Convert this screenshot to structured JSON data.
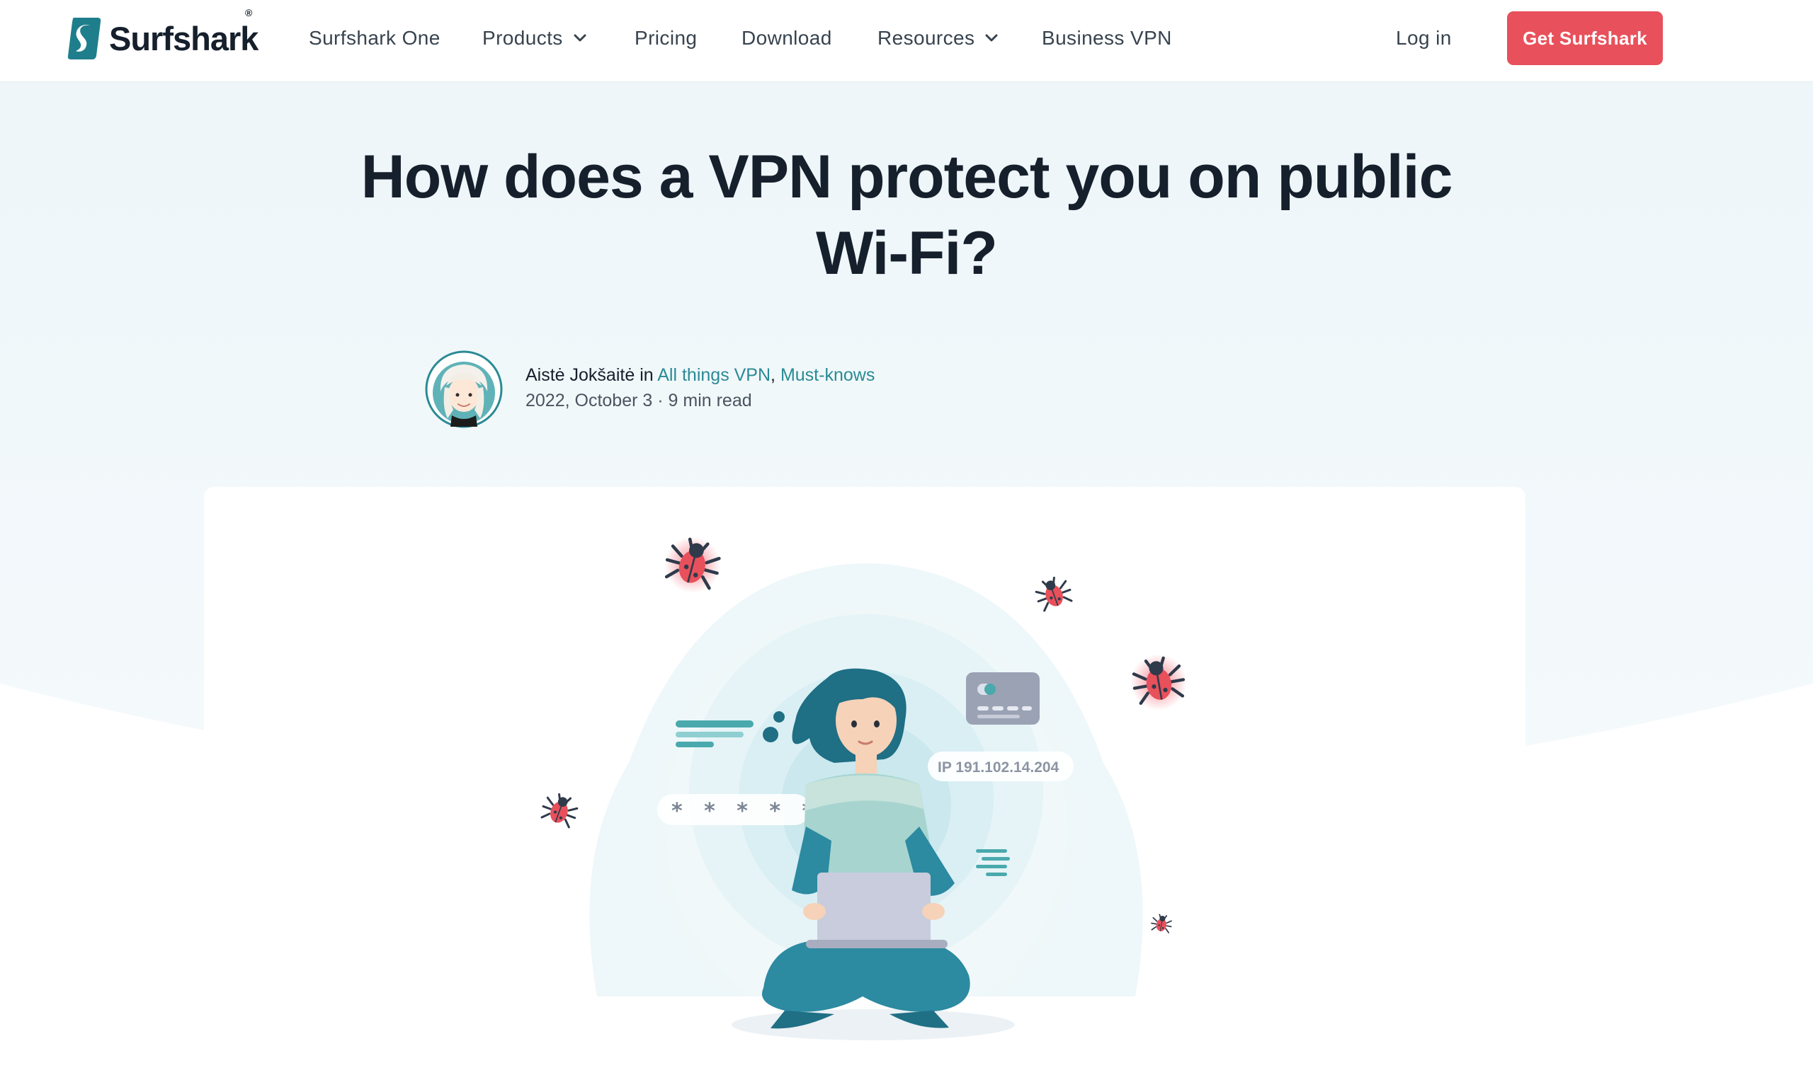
{
  "brand": {
    "name": "Surfshark",
    "registered_mark": "®",
    "logo_icon": "surfshark-s-icon",
    "colors": {
      "primary_text": "#16202c",
      "accent": "#e8505b",
      "link": "#2a8a94",
      "brand_teal": "#1f7e8c",
      "background": "#f4f9fb"
    }
  },
  "nav": {
    "items": [
      {
        "label": "Surfshark One",
        "has_dropdown": false
      },
      {
        "label": "Products",
        "has_dropdown": true
      },
      {
        "label": "Pricing",
        "has_dropdown": false
      },
      {
        "label": "Download",
        "has_dropdown": false
      },
      {
        "label": "Resources",
        "has_dropdown": true
      },
      {
        "label": "Business VPN",
        "has_dropdown": false
      }
    ],
    "login_label": "Log in",
    "cta_label": "Get Surfshark"
  },
  "article": {
    "title": "How does a VPN protect you on public Wi-Fi?",
    "author": "Aistė Jokšaitė",
    "in_word": "in",
    "categories": [
      "All things VPN",
      "Must-knows"
    ],
    "category_separator": ",",
    "date": "2022, October 3",
    "separator": "·",
    "read_time": "9 min read"
  },
  "illustration": {
    "ip_label": "IP 191.102.14.204",
    "password_mask": "* * * * *",
    "icons": [
      "bug-icon",
      "credit-card-icon",
      "laptop-icon",
      "person-illustration"
    ]
  }
}
